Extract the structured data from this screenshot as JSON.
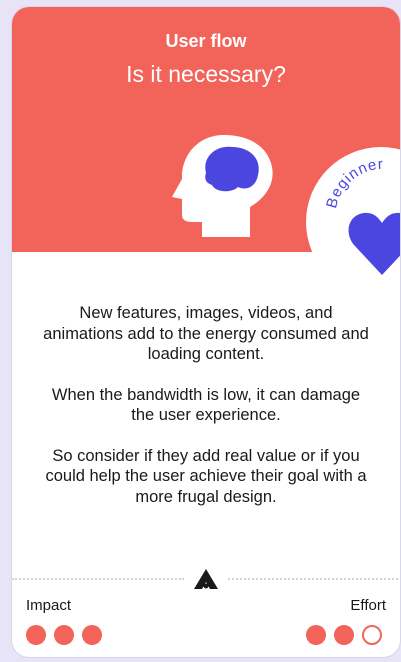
{
  "card": {
    "category": "User flow",
    "title": "Is it necessary?",
    "icon": "head-brain-icon",
    "badge": {
      "label": "Beginner",
      "icon": "heart-icon",
      "color": "#4b46e0"
    },
    "paragraphs": [
      "New features, images, videos, and animations add to the energy consumed and loading content.",
      "When the bandwidth is low, it can damage the user experience.",
      "So consider if they add real value or if you could help the user achieve their goal with a more frugal design."
    ],
    "impact": {
      "label": "Impact",
      "level": 3,
      "max": 3
    },
    "effort": {
      "label": "Effort",
      "level": 2,
      "max": 3
    },
    "colors": {
      "header": "#f2645a",
      "accent": "#4b46e0",
      "background": "#e6e4f6"
    }
  }
}
